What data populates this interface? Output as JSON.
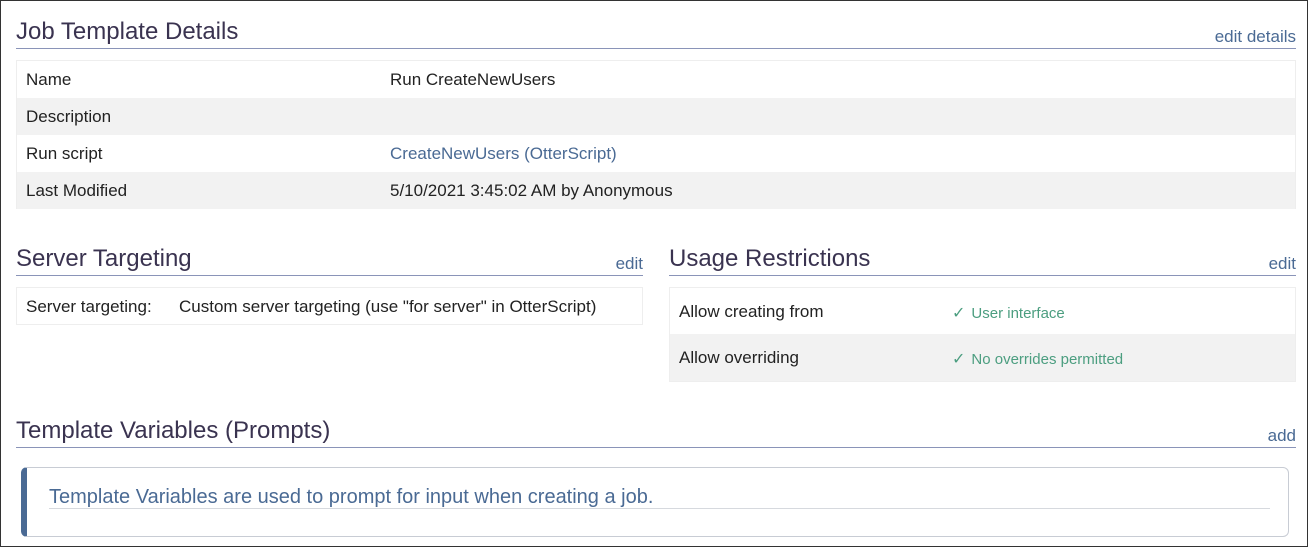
{
  "job_template": {
    "title": "Job Template Details",
    "action": "edit details",
    "rows": [
      {
        "label": "Name",
        "value": "Run CreateNewUsers"
      },
      {
        "label": "Description",
        "value": ""
      },
      {
        "label": "Run script",
        "value": "CreateNewUsers (OtterScript)"
      },
      {
        "label": "Last Modified",
        "value": "5/10/2021 3:45:02 AM by Anonymous"
      }
    ]
  },
  "server_targeting": {
    "title": "Server Targeting",
    "action": "edit",
    "label": "Server targeting:",
    "value": "Custom server targeting (use \"for server\" in OtterScript)"
  },
  "usage_restrictions": {
    "title": "Usage Restrictions",
    "action": "edit",
    "rows": [
      {
        "label": "Allow creating from",
        "value": "User interface"
      },
      {
        "label": "Allow overriding",
        "value": "No overrides permitted"
      }
    ],
    "check_glyph": "✓",
    "check_color": "#4c9e80"
  },
  "template_variables": {
    "title": "Template Variables (Prompts)",
    "action": "add",
    "info": "Template Variables are used to prompt for input when creating a job."
  },
  "colors": {
    "link": "#4a6a94",
    "heading": "#3a3350",
    "row_alt": "#f2f2f2",
    "callout_accent": "#4a6a94"
  }
}
